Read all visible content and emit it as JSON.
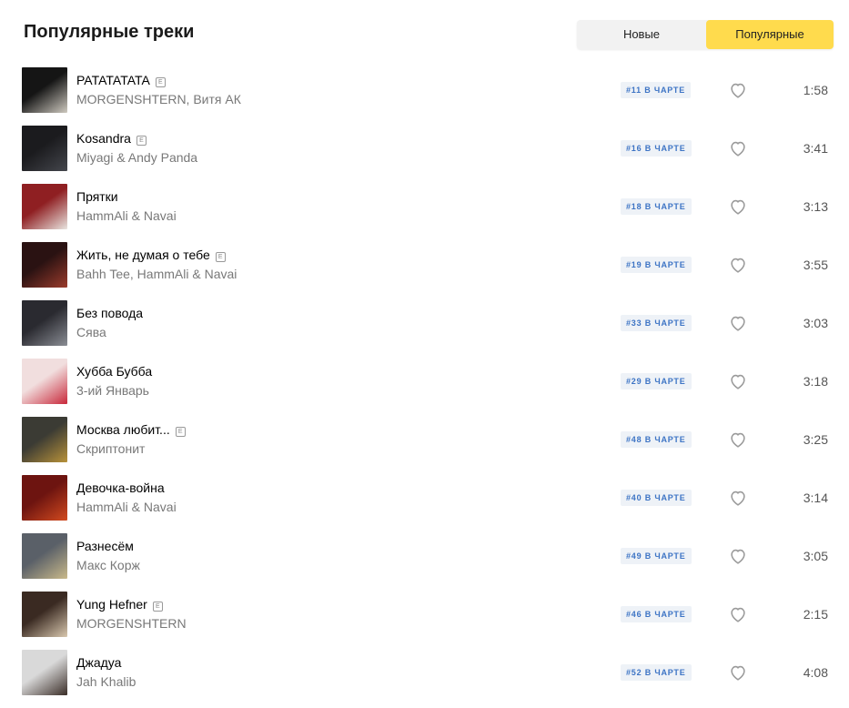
{
  "header": {
    "title": "Популярные треки",
    "tabs": {
      "new": "Новые",
      "popular": "Популярные"
    },
    "active_tab": "popular",
    "accent_color": "#ffdb4d"
  },
  "tracks": [
    {
      "name": "PATATATATA",
      "explicit": true,
      "artist": "MORGENSHTERN, Витя АК",
      "chart": "#11 В ЧАРТЕ",
      "duration": "1:58",
      "cover": [
        "#151515",
        "#cfcac0"
      ]
    },
    {
      "name": "Kosandra",
      "explicit": true,
      "artist": "Miyagi & Andy Panda",
      "chart": "#16 В ЧАРТЕ",
      "duration": "3:41",
      "cover": [
        "#1b1b1e",
        "#44464c"
      ]
    },
    {
      "name": "Прятки",
      "explicit": false,
      "artist": "HammAli & Navai",
      "chart": "#18 В ЧАРТЕ",
      "duration": "3:13",
      "cover": [
        "#8f1f22",
        "#e9e5e0"
      ]
    },
    {
      "name": "Жить, не думая о тебе",
      "explicit": true,
      "artist": "Bahh Tee, HammAli & Navai",
      "chart": "#19 В ЧАРТЕ",
      "duration": "3:55",
      "cover": [
        "#2a1212",
        "#9b3b2c"
      ]
    },
    {
      "name": "Без повода",
      "explicit": false,
      "artist": "Сява",
      "chart": "#33 В ЧАРТЕ",
      "duration": "3:03",
      "cover": [
        "#2a2a30",
        "#8a8d94"
      ]
    },
    {
      "name": "Хубба Бубба",
      "explicit": false,
      "artist": "3-ий Январь",
      "chart": "#29 В ЧАРТЕ",
      "duration": "3:18",
      "cover": [
        "#f1dede",
        "#c8283a"
      ]
    },
    {
      "name": "Москва любит...",
      "explicit": true,
      "artist": "Скриптонит",
      "chart": "#48 В ЧАРТЕ",
      "duration": "3:25",
      "cover": [
        "#3b3b34",
        "#b8923a"
      ]
    },
    {
      "name": "Девочка-война",
      "explicit": false,
      "artist": "HammAli & Navai",
      "chart": "#40 В ЧАРТЕ",
      "duration": "3:14",
      "cover": [
        "#6d1410",
        "#d24a1f"
      ]
    },
    {
      "name": "Разнесём",
      "explicit": false,
      "artist": "Макс Корж",
      "chart": "#49 В ЧАРТЕ",
      "duration": "3:05",
      "cover": [
        "#5a6068",
        "#c9b98a"
      ]
    },
    {
      "name": "Yung Hefner",
      "explicit": true,
      "artist": "MORGENSHTERN",
      "chart": "#46 В ЧАРТЕ",
      "duration": "2:15",
      "cover": [
        "#3a2a22",
        "#d8c7ae"
      ]
    },
    {
      "name": "Джадуа",
      "explicit": false,
      "artist": "Jah Khalib",
      "chart": "#52 В ЧАРТЕ",
      "duration": "4:08",
      "cover": [
        "#d9d9d9",
        "#3a2d27"
      ]
    }
  ],
  "icons": {
    "like": "heart-icon",
    "explicit": "E"
  }
}
